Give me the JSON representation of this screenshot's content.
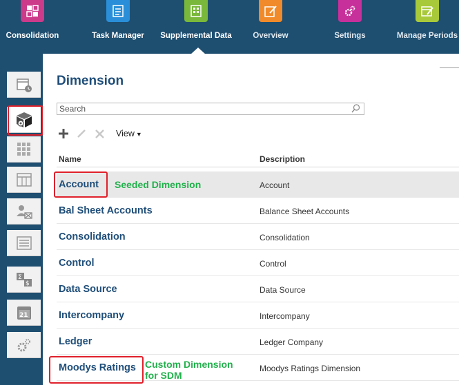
{
  "nav": {
    "items": [
      {
        "label": "Consolidation",
        "icon": "consolidation-icon",
        "color": "#cc3a8a"
      },
      {
        "label": "Task Manager",
        "icon": "task-manager-icon",
        "color": "#2a8fd8"
      },
      {
        "label": "Supplemental Data",
        "icon": "supplemental-data-icon",
        "color": "#79b83a"
      },
      {
        "label": "Overview",
        "icon": "overview-icon",
        "color": "#f08a2a"
      },
      {
        "label": "Settings",
        "icon": "settings-icon",
        "color": "#c7309a"
      },
      {
        "label": "Manage Periods",
        "icon": "manage-periods-icon",
        "color": "#a8c93a"
      }
    ],
    "active": "Supplemental Data"
  },
  "rail": {
    "tabs": [
      "calendar-clock-icon",
      "dimension-cube-icon",
      "grid-icon",
      "form-icon",
      "user-assign-icon",
      "list-icon",
      "sum-icon",
      "calendar-21-icon",
      "settings-gear-icon"
    ],
    "calendar_number": "21",
    "active": "dimension-cube-icon"
  },
  "panel": {
    "title": "Dimension",
    "search_placeholder": "Search",
    "toolbar": {
      "view_label": "View"
    },
    "columns": {
      "name": "Name",
      "description": "Description"
    },
    "rows": [
      {
        "name": "Account",
        "description": "Account",
        "selected": true
      },
      {
        "name": "Bal Sheet Accounts",
        "description": "Balance Sheet Accounts"
      },
      {
        "name": "Consolidation",
        "description": "Consolidation"
      },
      {
        "name": "Control",
        "description": "Control"
      },
      {
        "name": "Data Source",
        "description": "Data Source"
      },
      {
        "name": "Intercompany",
        "description": "Intercompany"
      },
      {
        "name": "Ledger",
        "description": "Ledger Company"
      },
      {
        "name": "Moodys Ratings",
        "description": "Moodys Ratings Dimension"
      }
    ]
  },
  "annotations": {
    "seeded": "Seeded Dimension",
    "custom_line1": "Custom Dimension",
    "custom_line2": "for SDM",
    "color": "#22b14c",
    "highlight_color": "#e0202b"
  },
  "colors": {
    "nav_bg": "#1e4e70",
    "title": "#1f4e79"
  }
}
